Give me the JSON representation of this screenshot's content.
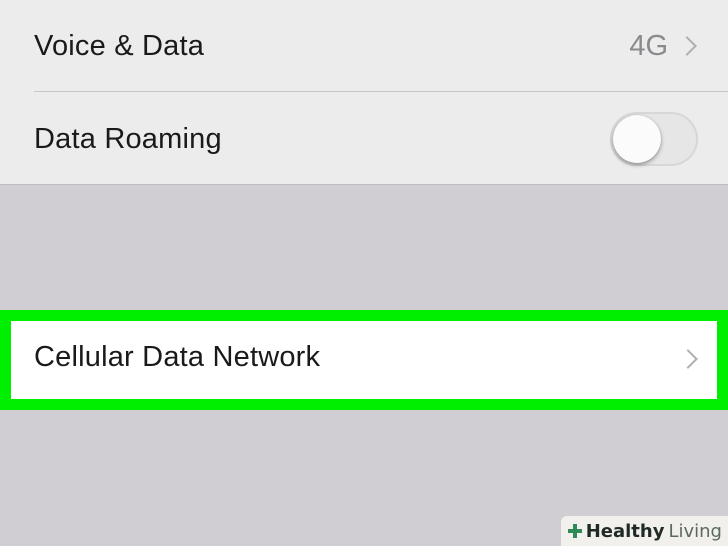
{
  "settings": {
    "voice_data": {
      "label": "Voice & Data",
      "value": "4G"
    },
    "data_roaming": {
      "label": "Data Roaming",
      "enabled": false
    },
    "cellular_data_network": {
      "label": "Cellular Data Network",
      "highlighted": true,
      "highlight_color": "#00ee00"
    }
  },
  "watermark": {
    "brand_bold": "Healthy",
    "brand_light": "Living"
  },
  "colors": {
    "group_background": "#ececec",
    "page_background": "#d0ced2",
    "highlight": "#00ee00",
    "secondary_text": "#8a8a8e"
  }
}
